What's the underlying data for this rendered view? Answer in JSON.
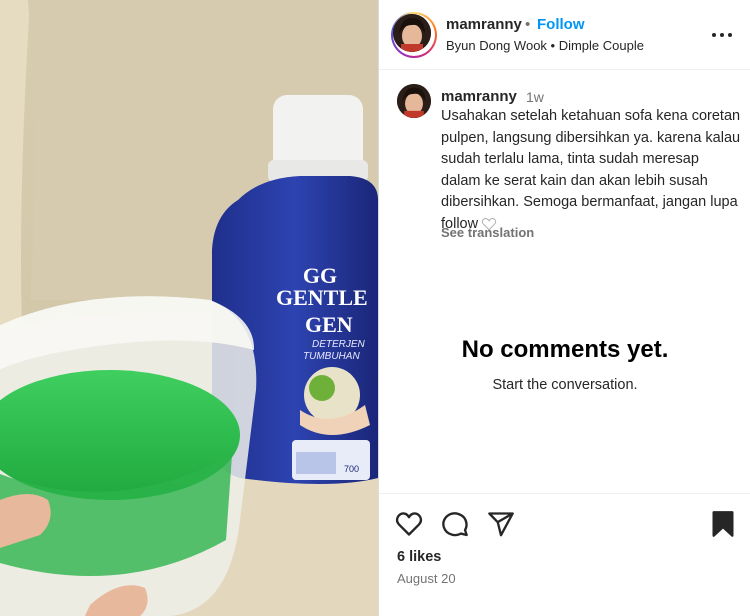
{
  "post": {
    "username": "mamranny",
    "dot": "•",
    "follow_label": "Follow",
    "subtitle": "Byun Dong Wook • Dimple Couple"
  },
  "media": {
    "bottle_label_lines": [
      "GENTLE",
      "GEN",
      "DETERJEN",
      "TUMBUHAN"
    ],
    "bottle_logo": "GG",
    "bottle_volume": "700"
  },
  "caption": {
    "username": "mamranny",
    "time": "1w",
    "text": "Usahakan setelah ketahuan sofa kena coretan pulpen, langsung dibersihkan ya. karena kalau sudah terlalu lama, tinta sudah meresap dalam ke serat kain dan akan lebih susah dibersihkan. Semoga bermanfaat, jangan lupa follow",
    "see_translation": "See translation"
  },
  "comments": {
    "empty_title": "No comments yet.",
    "empty_subtitle": "Start the conversation."
  },
  "footer": {
    "likes": "6 likes",
    "date": "August 20"
  },
  "icons": {
    "like": "heart-icon",
    "comment": "comment-icon",
    "share": "share-icon",
    "save": "bookmark-icon",
    "more": "more-icon"
  },
  "colors": {
    "follow": "#0095f6",
    "muted": "#737373",
    "text": "#262626"
  }
}
